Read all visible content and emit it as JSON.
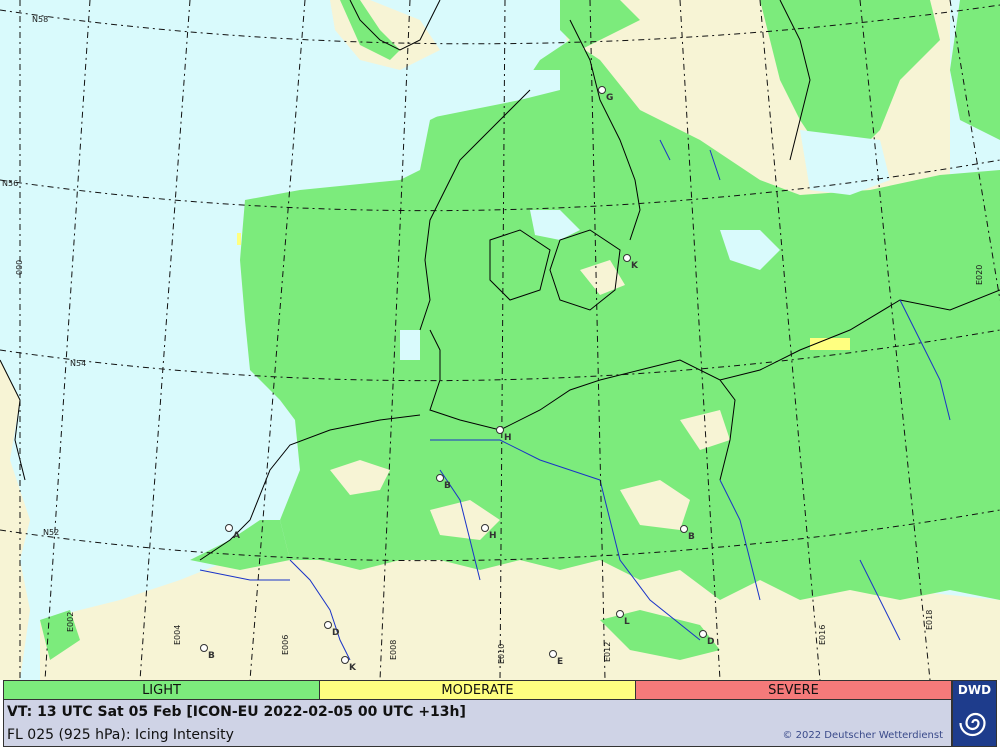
{
  "map": {
    "grid_labels": {
      "lat_n58": "N58",
      "lat_n56": "N56",
      "lat_n54": "N54",
      "lat_n52": "N52",
      "lon_000": "000",
      "lon_e002": "E002",
      "lon_e004": "E004",
      "lon_e006": "E006",
      "lon_e008": "E008",
      "lon_e010": "E010",
      "lon_e012": "E012",
      "lon_e016": "E016",
      "lon_e018": "E018",
      "lon_e020": "E020"
    },
    "city_markers": {
      "gothenburg": "G",
      "copenhagen": "K",
      "hamburg": "H",
      "bremen": "B",
      "hannover": "H",
      "amsterdam": "A",
      "berlin": "B",
      "leipzig": "L",
      "dresden": "D",
      "brussels": "B",
      "dusseldorf": "D",
      "koln": "K",
      "erfurt": "E"
    },
    "colors": {
      "sea": "#d9fafc",
      "land_no_icing": "#f7f4d5",
      "light": "#7ceb7c",
      "moderate": "#ffff80",
      "severe": "#f57a7a",
      "coastline": "#000000",
      "rivers": "#1a33c8"
    }
  },
  "legend": {
    "light": "LIGHT",
    "moderate": "MODERATE",
    "severe": "SEVERE"
  },
  "info": {
    "valid_time": "VT: 13 UTC Sat  05 Feb [ICON-EU 2022-02-05 00 UTC +13h]",
    "level_product": "FL 025 (925 hPa): Icing Intensity",
    "copyright": "© 2022 Deutscher Wetterdienst"
  },
  "logo": {
    "text": "DWD",
    "colors": {
      "background": "#1e3c8c"
    }
  }
}
